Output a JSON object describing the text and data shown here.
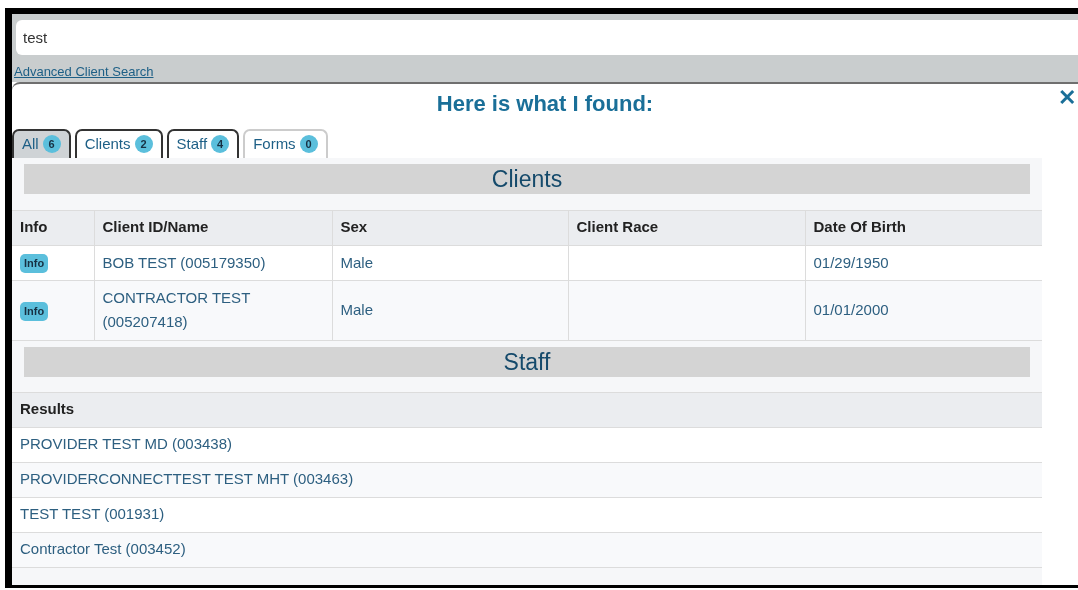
{
  "search": {
    "value": "test"
  },
  "advanced_link": "Advanced Client Search",
  "results_title": "Here is what I found:",
  "close": "✕",
  "tabs": [
    {
      "label": "All",
      "count": "6",
      "selected": true,
      "disabled": false
    },
    {
      "label": "Clients",
      "count": "2",
      "selected": false,
      "disabled": false
    },
    {
      "label": "Staff",
      "count": "4",
      "selected": false,
      "disabled": false
    },
    {
      "label": "Forms",
      "count": "0",
      "selected": false,
      "disabled": true
    }
  ],
  "clients": {
    "heading": "Clients",
    "columns": [
      "Info",
      "Client ID/Name",
      "Sex",
      "Client Race",
      "Date Of Birth"
    ],
    "rows": [
      {
        "info": "Info",
        "name": "BOB TEST (005179350)",
        "sex": "Male",
        "dob": "01/29/1950"
      },
      {
        "info": "Info",
        "name": "CONTRACTOR TEST (005207418)",
        "sex": "Male",
        "dob": "01/01/2000"
      }
    ]
  },
  "staff": {
    "heading": "Staff",
    "column": "Results",
    "rows": [
      "PROVIDER TEST MD (003438)",
      "PROVIDERCONNECTTEST TEST MHT (003463)",
      "TEST TEST (001931)",
      "Contractor Test (003452)"
    ]
  }
}
